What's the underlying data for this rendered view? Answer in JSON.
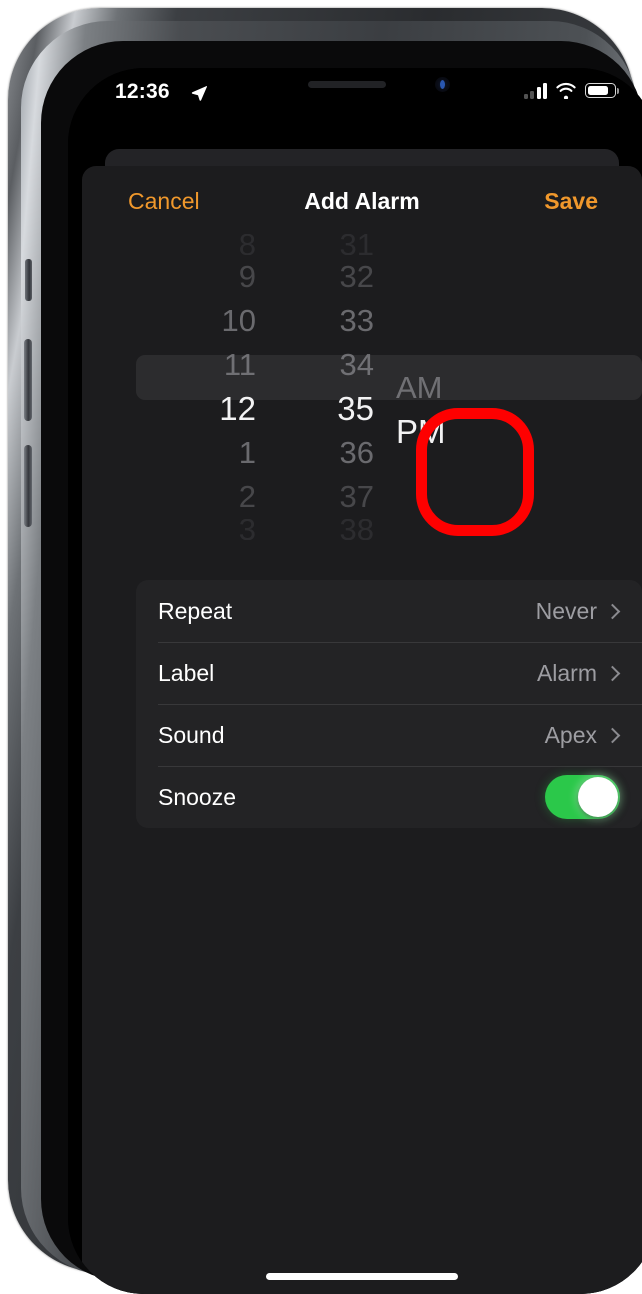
{
  "status_bar": {
    "time": "12:36",
    "location_icon": "location-arrow-icon",
    "signal_icon": "cellular-signal-icon",
    "wifi_icon": "wifi-icon",
    "battery_icon": "battery-icon",
    "battery_level_percent": 75
  },
  "nav": {
    "cancel_label": "Cancel",
    "title": "Add Alarm",
    "save_label": "Save"
  },
  "picker": {
    "hours": {
      "items": [
        "8",
        "9",
        "10",
        "11",
        "12",
        "1",
        "2",
        "3"
      ],
      "selected": "12"
    },
    "minutes": {
      "items": [
        "31",
        "32",
        "33",
        "34",
        "35",
        "36",
        "37",
        "38"
      ],
      "selected": "35"
    },
    "meridiem": {
      "items": [
        "AM",
        "PM"
      ],
      "selected": "PM"
    }
  },
  "annotation": {
    "shape": "rounded-rectangle-highlight",
    "color": "#FE0000",
    "target": "meridiem-column"
  },
  "settings": {
    "rows": [
      {
        "label": "Repeat",
        "value": "Never",
        "accessory": "chevron-right-icon"
      },
      {
        "label": "Label",
        "value": "Alarm",
        "accessory": "chevron-right-icon"
      },
      {
        "label": "Sound",
        "value": "Apex",
        "accessory": "chevron-right-icon"
      },
      {
        "label": "Snooze",
        "value": "",
        "accessory": "toggle-switch",
        "toggle_on": true
      }
    ]
  },
  "colors": {
    "accent": "#F0982C",
    "toggle_on": "#2BC84A",
    "screen_bg": "#1C1C1E",
    "card_bg": "#232325",
    "selection_band": "#2C2C2E"
  },
  "home_indicator": "home-indicator"
}
